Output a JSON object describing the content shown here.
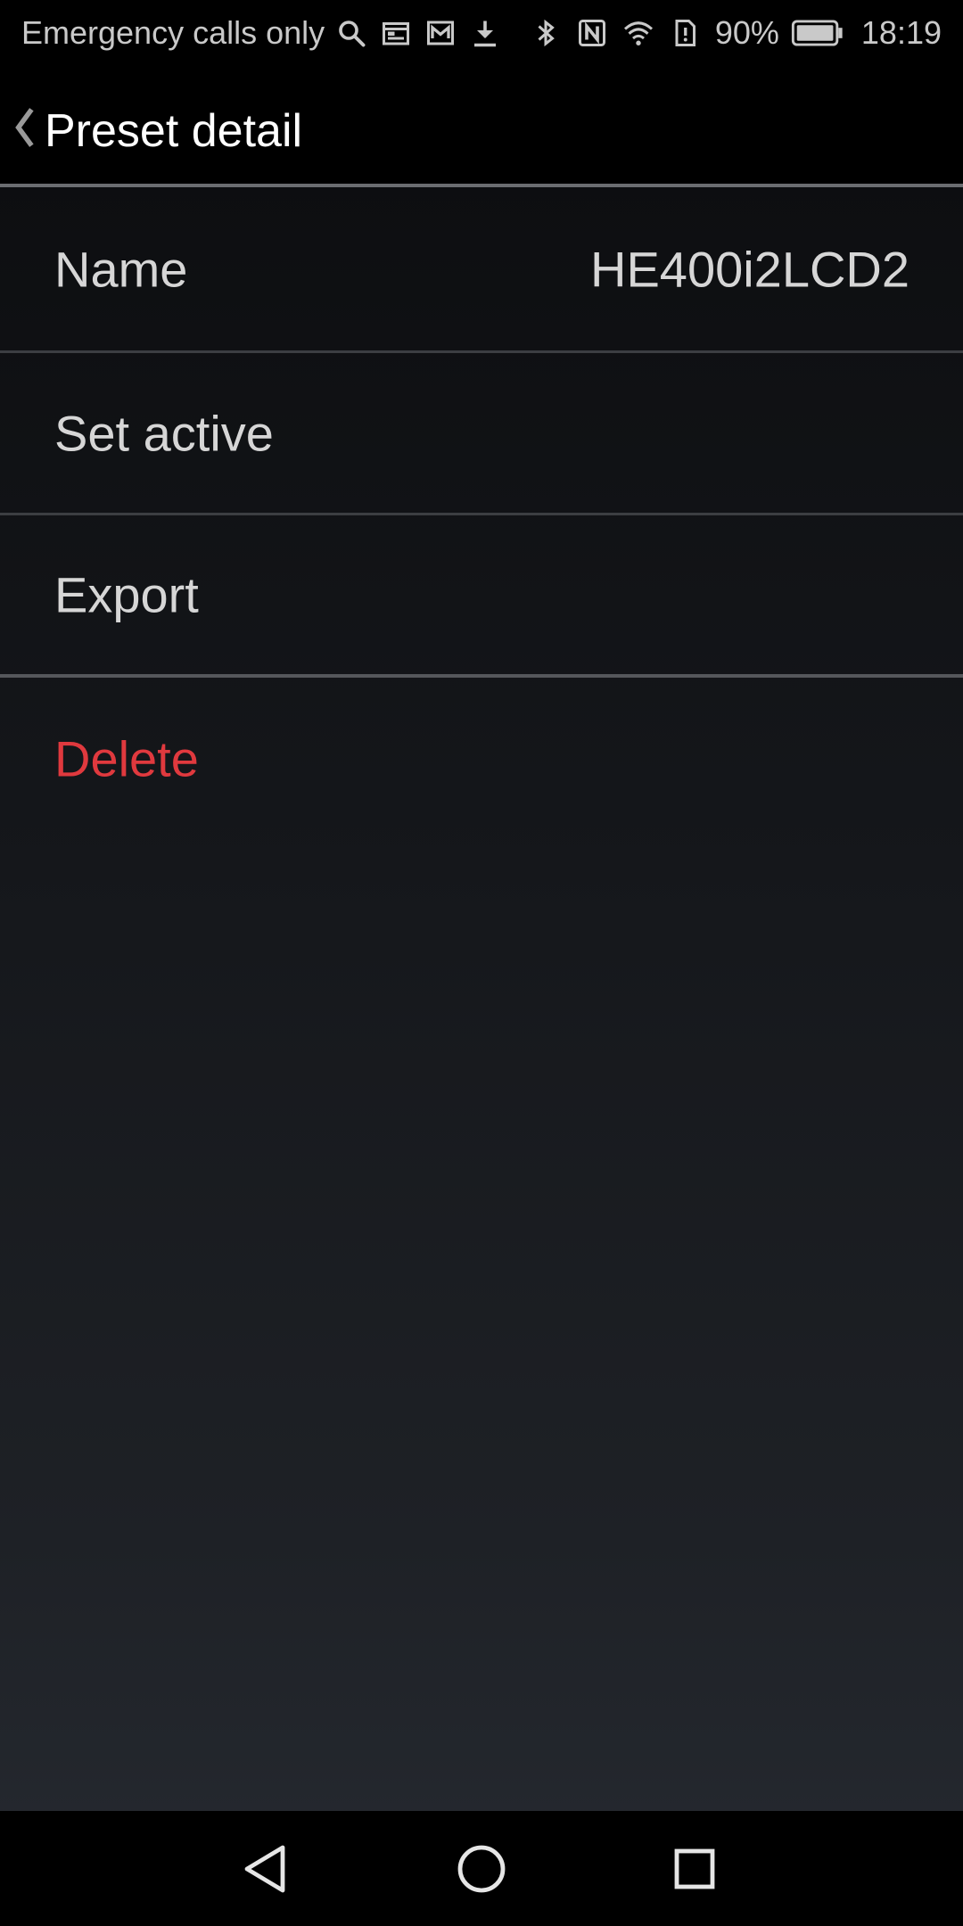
{
  "status_bar": {
    "carrier_text": "Emergency calls only",
    "battery_percent": "90%",
    "time": "18:19",
    "left_icons": [
      "search-icon",
      "calendar-icon",
      "mail-icon",
      "download-icon"
    ],
    "right_icons": [
      "bluetooth-icon",
      "nfc-icon",
      "wifi-icon",
      "sim-alert-icon",
      "battery-icon"
    ]
  },
  "app_bar": {
    "title": "Preset detail",
    "back_icon": "chevron-left-icon"
  },
  "rows": {
    "name_label": "Name",
    "name_value": "HE400i2LCD2",
    "set_active_label": "Set active",
    "export_label": "Export",
    "delete_label": "Delete"
  },
  "colors": {
    "delete": "#e0393e",
    "text": "#d6d6d6",
    "background": "#0b0c0e"
  },
  "nav_bar": {
    "icons": [
      "back-triangle-icon",
      "home-circle-icon",
      "recents-square-icon"
    ]
  }
}
